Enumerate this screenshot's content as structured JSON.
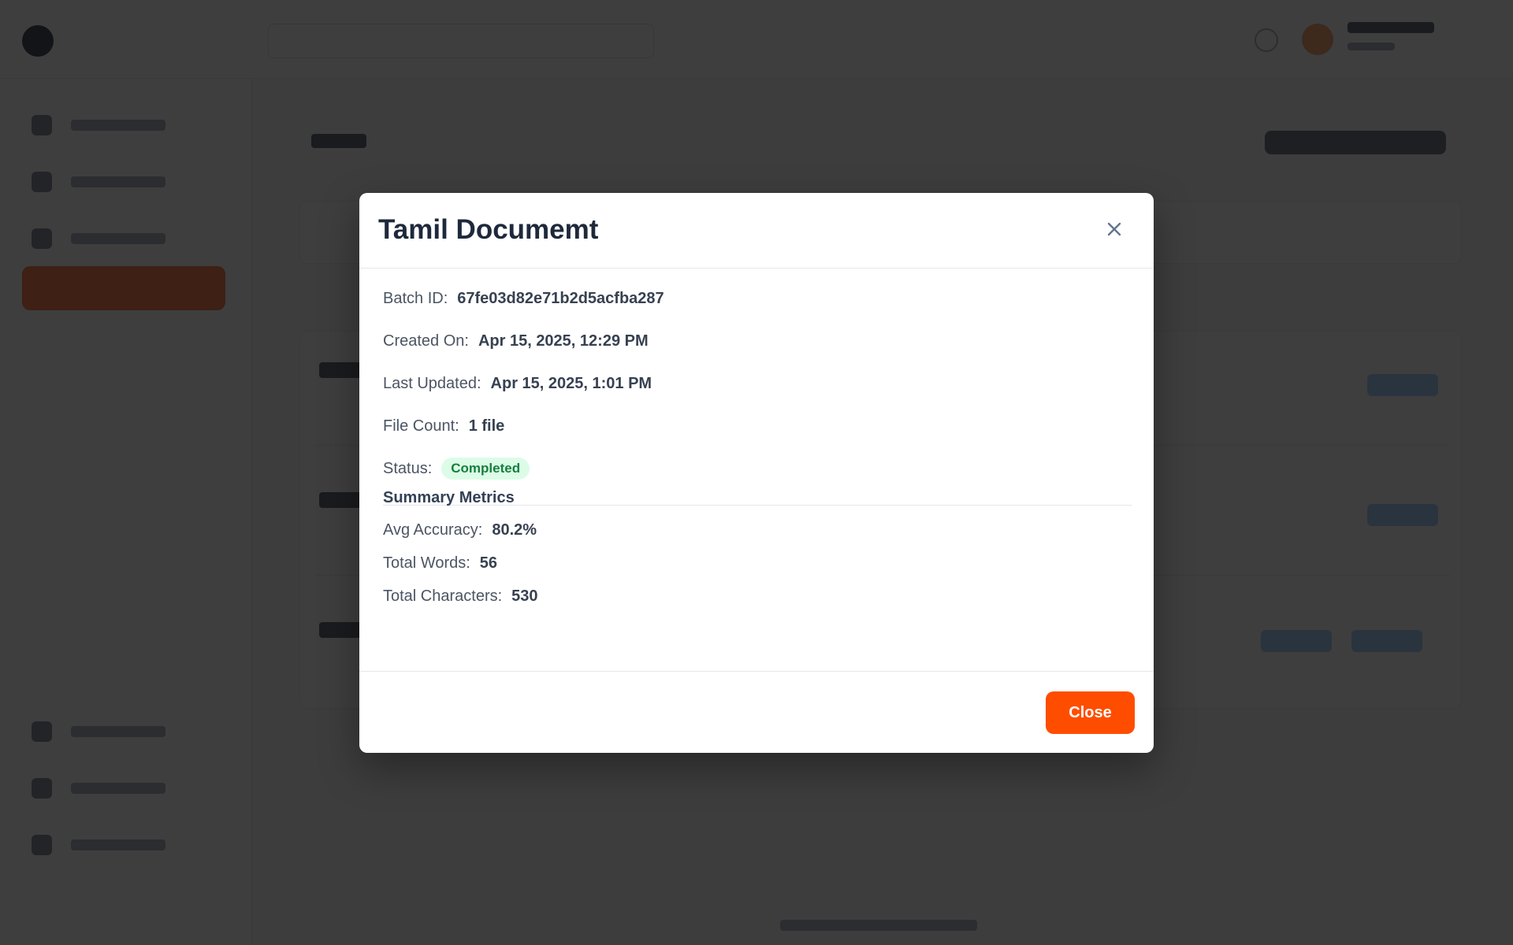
{
  "modal": {
    "title": "Tamil Documemt",
    "fields": {
      "batch_id": {
        "label": "Batch ID:",
        "value": "67fe03d82e71b2d5acfba287"
      },
      "created_on": {
        "label": "Created On:",
        "value": "Apr 15, 2025, 12:29 PM"
      },
      "last_updated": {
        "label": "Last Updated:",
        "value": "Apr 15, 2025, 1:01 PM"
      },
      "file_count": {
        "label": "File Count:",
        "value": "1 file"
      },
      "status": {
        "label": "Status:",
        "value": "Completed",
        "color": "#15803d",
        "background": "#dcfce7"
      }
    },
    "summary": {
      "title": "Summary Metrics",
      "avg_accuracy": {
        "label": "Avg Accuracy:",
        "value": "80.2%"
      },
      "total_words": {
        "label": "Total Words:",
        "value": "56"
      },
      "total_characters": {
        "label": "Total Characters:",
        "value": "530"
      }
    },
    "close_button_label": "Close",
    "close_icon": "close-icon"
  },
  "theme": {
    "accent": "#ff4d00",
    "overlay": "rgba(20,20,20,0.82)"
  }
}
